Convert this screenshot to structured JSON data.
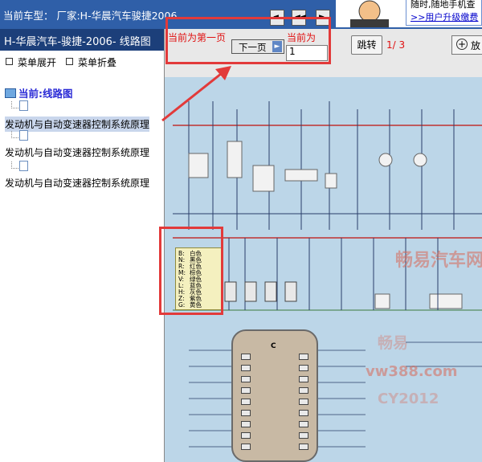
{
  "top_bar": {
    "title": "当前车型： 厂家:H-华晨汽车骏捷2006",
    "ad_line1": "随时,随地手机查",
    "ad_line2": ">>用户升级缴费"
  },
  "left_panel": {
    "header_title": "H-华晨汽车-骏捷-2006- 线路图",
    "menu_expand": "菜单展开",
    "menu_collapse": "菜单折叠",
    "tree_root": "当前:线路图",
    "tree_items": [
      "发动机与自动变速器控制系统原理",
      "发动机与自动变速器控制系统原理",
      "发动机与自动变速器控制系统原理"
    ]
  },
  "toolbar": {
    "next_label": "下一页",
    "page_label": "当前为",
    "page_value": "1",
    "jump_label": "跳转",
    "page_count": "1/ 3",
    "zoom_label": "放"
  },
  "annotations": {
    "first_page_note": "当前为第一页"
  },
  "legend": {
    "items": [
      {
        "code": "B:",
        "name": "白色"
      },
      {
        "code": "N:",
        "name": "黑色"
      },
      {
        "code": "R:",
        "name": "红色"
      },
      {
        "code": "M:",
        "name": "棕色"
      },
      {
        "code": "V:",
        "name": "绿色"
      },
      {
        "code": "L:",
        "name": "蓝色"
      },
      {
        "code": "H:",
        "name": "灰色"
      },
      {
        "code": "Z:",
        "name": "紫色"
      },
      {
        "code": "G:",
        "name": "黄色"
      }
    ]
  },
  "watermark": {
    "line1": "畅易汽车网",
    "line2": "畅易",
    "line3": "vw388.com",
    "line4": "CY2012"
  },
  "connector": {
    "label": "C"
  },
  "colors": {
    "top_bar": "#2f5fa8",
    "left_header": "#1c3f7a",
    "annotation": "#e23a3a",
    "diagram_bg": "#bcd6e8",
    "legend_bg": "#f4f0bf"
  }
}
